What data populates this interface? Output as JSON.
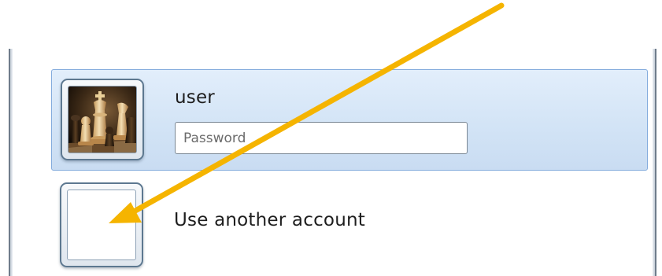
{
  "accounts": [
    {
      "name": "user",
      "avatar_icon": "chess-pieces-avatar-icon",
      "password_placeholder": "Password",
      "password_value": ""
    }
  ],
  "other_account": {
    "label": "Use another account",
    "avatar_icon": "blank-avatar-icon"
  },
  "colors": {
    "selection_background": "#d3e4f6",
    "selection_border": "#84acdd",
    "annotation_arrow": "#f5b400"
  },
  "annotation": {
    "icon": "arrow-annotation-icon"
  }
}
